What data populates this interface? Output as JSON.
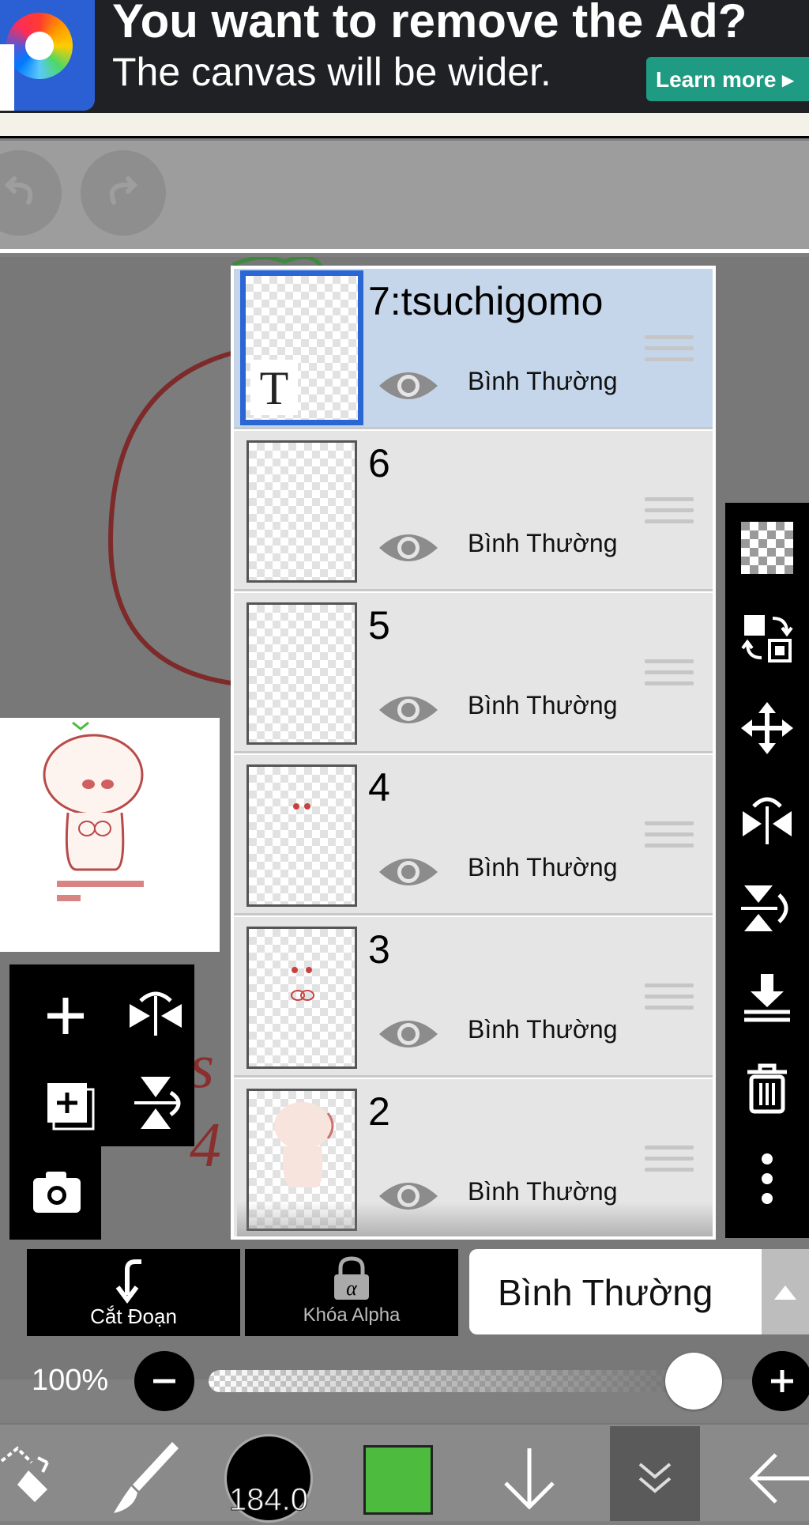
{
  "ad": {
    "title": "You want to remove the Ad?",
    "subtitle": "The canvas will be wider.",
    "learn_more": "Learn more ▸",
    "logo_icon": "ibispaint-logo-icon"
  },
  "toolbar": {
    "undo_icon": "undo-icon",
    "redo_icon": "redo-icon"
  },
  "layers": [
    {
      "name": "7:tsuchigomo",
      "blend": "Bình Thường",
      "visible": true,
      "selected": true,
      "type": "text"
    },
    {
      "name": "6",
      "blend": "Bình Thường",
      "visible": true,
      "selected": false
    },
    {
      "name": "5",
      "blend": "Bình Thường",
      "visible": true,
      "selected": false
    },
    {
      "name": "4",
      "blend": "Bình Thường",
      "visible": true,
      "selected": false
    },
    {
      "name": "3",
      "blend": "Bình Thường",
      "visible": true,
      "selected": false
    },
    {
      "name": "2",
      "blend": "Bình Thường",
      "visible": true,
      "selected": false
    }
  ],
  "right_tools": [
    "transparent-bg-icon",
    "copy-layer-icon",
    "move-icon",
    "flip-horizontal-icon",
    "flip-vertical-icon",
    "merge-down-icon",
    "trash-icon",
    "more-icon"
  ],
  "left_tools": [
    "add-layer-icon",
    "flip-horizontal-icon",
    "add-copy-icon",
    "flip-vertical-icon",
    "camera-icon"
  ],
  "actions": {
    "clipping_label": "Cắt Đoạn",
    "alpha_lock_label": "Khóa Alpha",
    "blend_mode_value": "Bình Thường"
  },
  "opacity": {
    "value_label": "100%",
    "fraction": 1.0
  },
  "bottom_bar": {
    "brush_size": "184.0",
    "color": "#4dbb3e"
  },
  "colors": {
    "accent_selected": "#2a66d4",
    "selected_row": "#c5d6ea",
    "ad_button": "#1f9b83"
  }
}
